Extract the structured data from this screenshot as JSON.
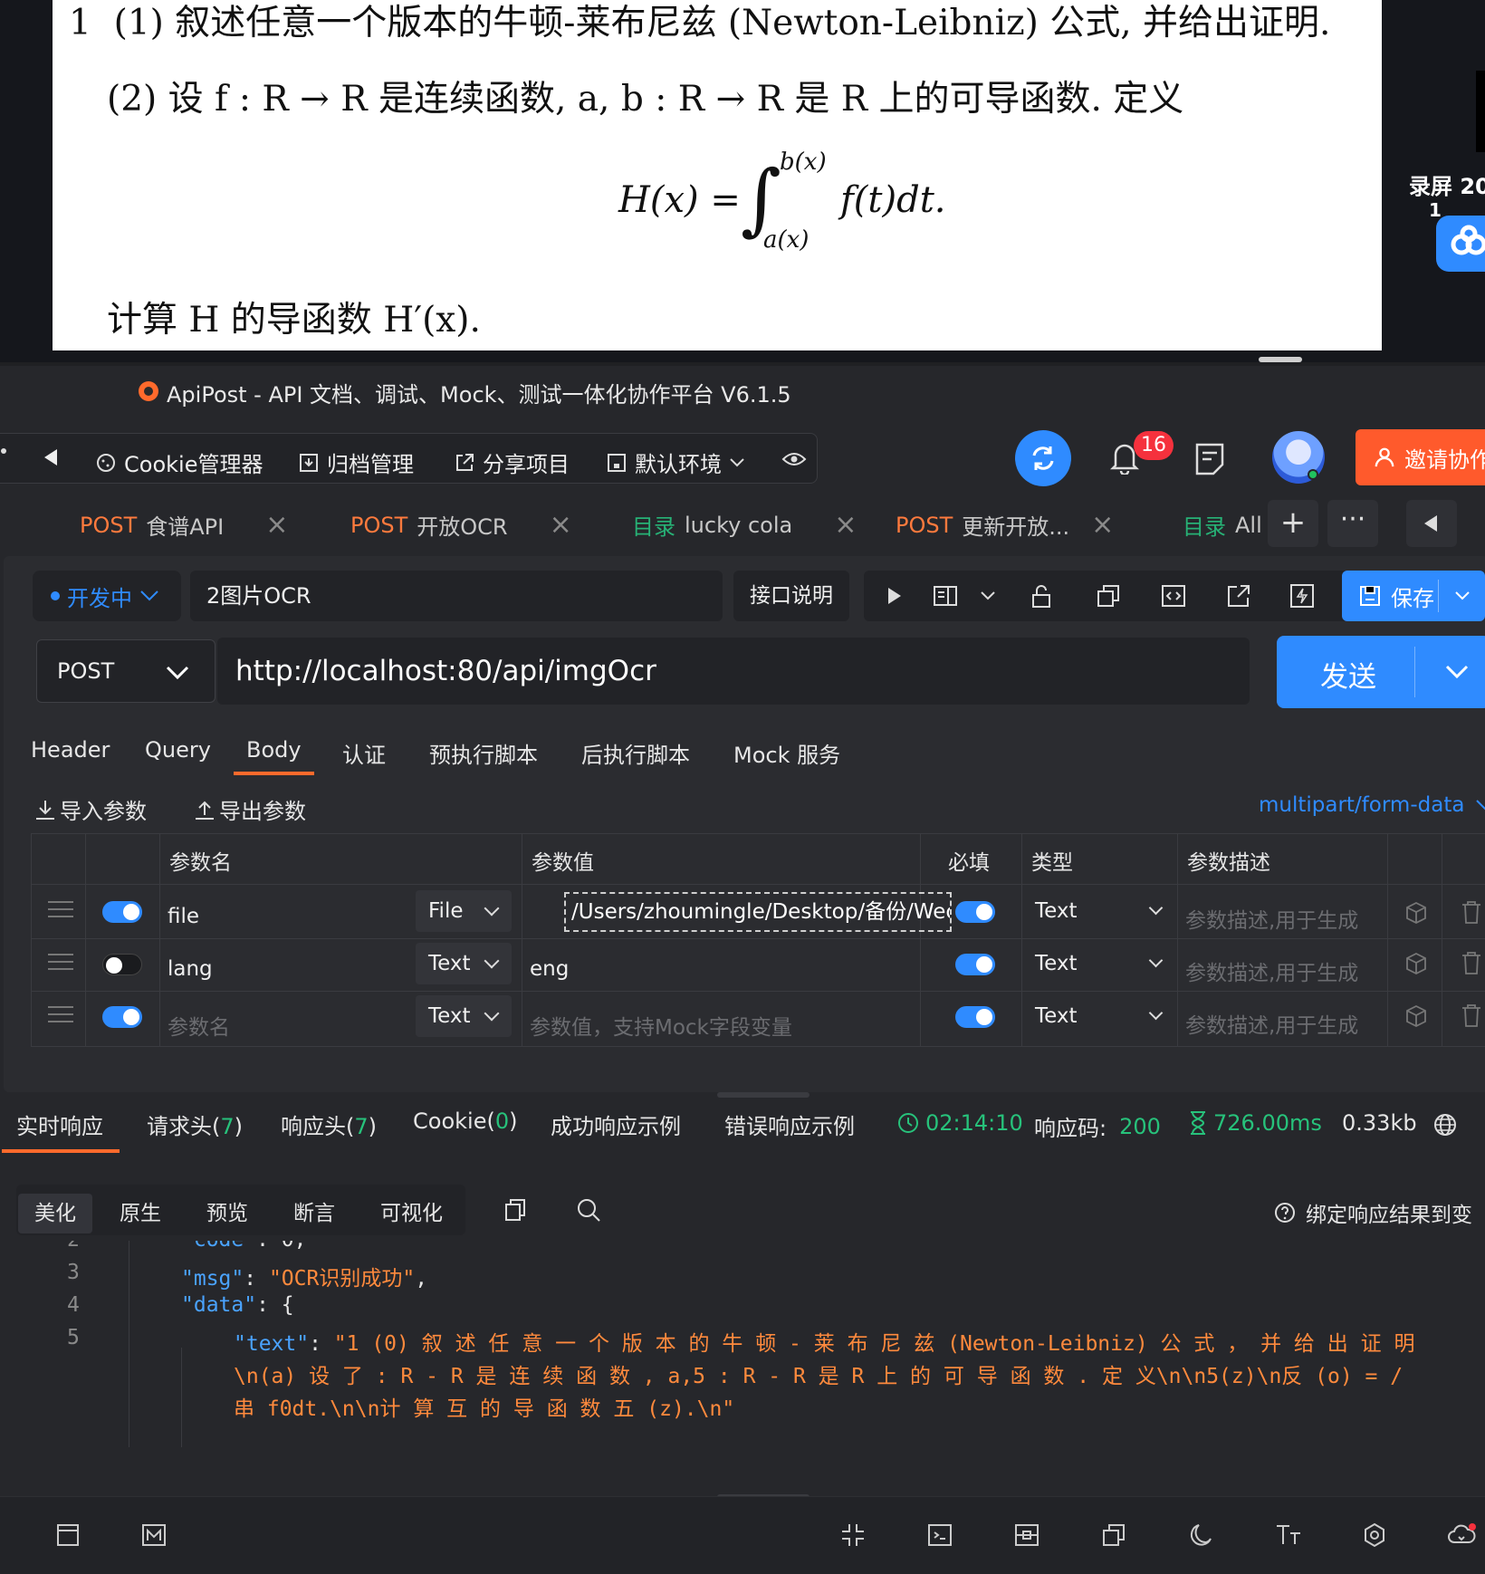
{
  "document": {
    "line1_num": "1",
    "line1": "(1) 叙述任意一个版本的牛顿-莱布尼兹 (Newton-Leibniz) 公式, 并给出证明.",
    "line2": "(2) 设 f : R → R 是连续函数, a, b : R → R 是 R 上的可导函数. 定义",
    "formula_lhs": "H(x) =",
    "formula_upper": "b(x)",
    "formula_lower": "a(x)",
    "formula_integrand": "f(t)dt.",
    "line3": "计算 H 的导函数 H′(x).",
    "side_label": "录屏 20",
    "side_label2": "1"
  },
  "app": {
    "title": "ApiPost - API 文档、调试、Mock、测试一体化协作平台 V6.1.5",
    "toolbar": {
      "cookie": "Cookie管理器",
      "archive": "归档管理",
      "share": "分享项目",
      "env": "默认环境",
      "notifications": "16",
      "invite": "邀请协作"
    },
    "tabs": [
      {
        "method": "POST",
        "name": "食谱API"
      },
      {
        "method": "POST",
        "name": "开放OCR"
      },
      {
        "method": "目录",
        "name": "lucky cola"
      },
      {
        "method": "POST",
        "name": "更新开放..."
      },
      {
        "method": "目录",
        "name": "All"
      }
    ],
    "request": {
      "status": "开发中",
      "name": "2图片OCR",
      "doc_button": "接口说明",
      "save": "保存",
      "method": "POST",
      "url": "http://localhost:80/api/imgOcr",
      "send": "发送"
    },
    "sub_tabs": [
      "Header",
      "Query",
      "Body",
      "认证",
      "预执行脚本",
      "后执行脚本",
      "Mock 服务"
    ],
    "import_params": "导入参数",
    "export_params": "导出参数",
    "content_type": "multipart/form-data",
    "params_header": {
      "name": "参数名",
      "value": "参数值",
      "required": "必填",
      "type": "类型",
      "desc": "参数描述"
    },
    "params": [
      {
        "name": "file",
        "kind": "File",
        "value": "/Users/zhoumingle/Desktop/备份/Wech",
        "type": "Text",
        "desc_placeholder": "参数描述,用于生成",
        "enabled": true,
        "required": true
      },
      {
        "name": "lang",
        "kind": "Text",
        "value": "eng",
        "type": "Text",
        "desc_placeholder": "参数描述,用于生成",
        "enabled": false,
        "required": true
      },
      {
        "name_placeholder": "参数名",
        "kind": "Text",
        "value_placeholder": "参数值，支持Mock字段变量",
        "type": "Text",
        "desc_placeholder": "参数描述,用于生成",
        "enabled": true,
        "required": true
      }
    ],
    "response_tabs": {
      "live": "实时响应",
      "req_headers": "请求头(",
      "req_headers_count": "7",
      "resp_headers": "响应头(",
      "resp_headers_count": "7",
      "cookie": "Cookie(",
      "cookie_count": "0",
      "close_paren": ")",
      "success_example": "成功响应示例",
      "error_example": "错误响应示例"
    },
    "response_stats": {
      "time": "02:14:10",
      "code_label": "响应码:",
      "code": "200",
      "duration": "726.00ms",
      "size": "0.33kb"
    },
    "view_modes": [
      "美化",
      "原生",
      "预览",
      "断言",
      "可视化"
    ],
    "bind_result": "绑定响应结果到变",
    "code_lines": {
      "l2_num": "2",
      "l3_num": "3",
      "l4_num": "4",
      "l5_num": "5",
      "l2_key": "\"code\"",
      "l2_rest": ": 0,",
      "l3_key": "\"msg\"",
      "l3_val": "\"OCR识别成功\"",
      "l4_key": "\"data\"",
      "l4_rest": ": {",
      "l5_key": "\"text\"",
      "l5_val_a": "\"1 (0) 叙 述 任 意 一 个 版 本 的 牛 顿 - 莱 布 尼 兹 (Newton-Leibniz) 公 式 ， 并 给 出 证 明",
      "l5_val_b": "\\n(a) 设 了 : R - R 是 连 续 函 数 , a,5 : R - R 是 R 上 的 可 导 函 数 . 定 义\\n\\n5(z)\\n反 (o) = /",
      "l5_val_c": "串 f0dt.\\n\\n计 算 互 的 导 函 数 五 (z).\\n\""
    }
  }
}
